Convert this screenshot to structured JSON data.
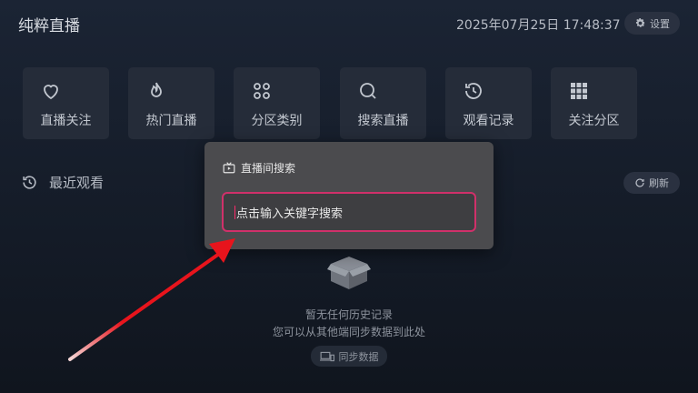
{
  "header": {
    "app_title": "纯粹直播",
    "datetime": "2025年07月25日 17:48:37",
    "settings_label": "设置"
  },
  "tiles": [
    {
      "label": "直播关注",
      "icon": "heart-icon"
    },
    {
      "label": "热门直播",
      "icon": "flame-icon"
    },
    {
      "label": "分区类别",
      "icon": "categories-icon"
    },
    {
      "label": "搜索直播",
      "icon": "search-icon"
    },
    {
      "label": "观看记录",
      "icon": "history-icon"
    },
    {
      "label": "关注分区",
      "icon": "grid-icon"
    }
  ],
  "recent": {
    "title": "最近观看",
    "refresh_label": "刷新"
  },
  "empty": {
    "line1": "暂无任何历史记录",
    "line2": "您可以从其他端同步数据到此处",
    "sync_label": "同步数据"
  },
  "dialog": {
    "title": "直播间搜索",
    "search_placeholder": "点击输入关键字搜索"
  },
  "colors": {
    "accent": "#d0306a",
    "arrow": "#e8141c",
    "dialog_bg": "#4b4b4e"
  }
}
